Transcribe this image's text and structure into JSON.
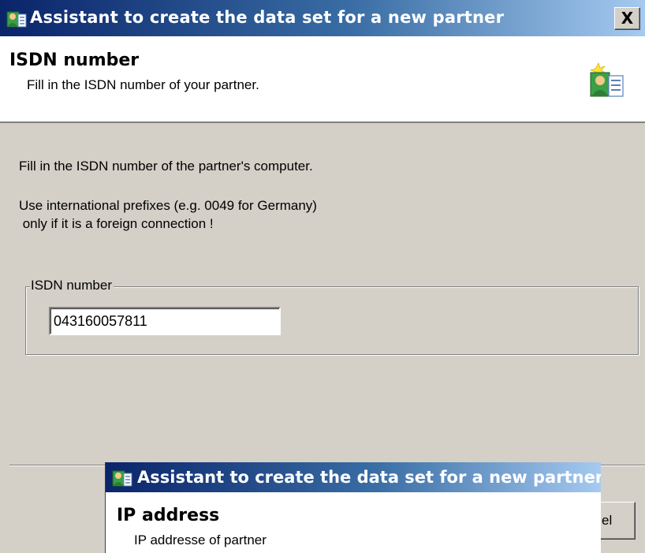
{
  "window": {
    "title": "Assistant to create the data set for a new partner",
    "close_label": "X"
  },
  "header": {
    "title": "ISDN number",
    "subtitle": "Fill in the ISDN number of your partner.",
    "icon": "partner-wizard-icon"
  },
  "body": {
    "line1": "Fill in the ISDN number of the partner's computer.",
    "line2": "Use international prefixes (e.g. 0049 for Germany)",
    "line3": " only if it is a foreign connection !"
  },
  "isdn_group": {
    "label": "ISDN number",
    "value": "043160057811"
  },
  "buttons": {
    "cancel_label": "Cancel",
    "cancel_visible_label": "el"
  },
  "overlay_window": {
    "title": "Assistant to create the data set for a new partner",
    "header_title": "IP address",
    "header_subtitle": "IP addresse of partner"
  },
  "colors": {
    "titlebar_start": "#0a246a",
    "titlebar_end": "#a6caf0",
    "dialog_face": "#d4d0c8"
  }
}
